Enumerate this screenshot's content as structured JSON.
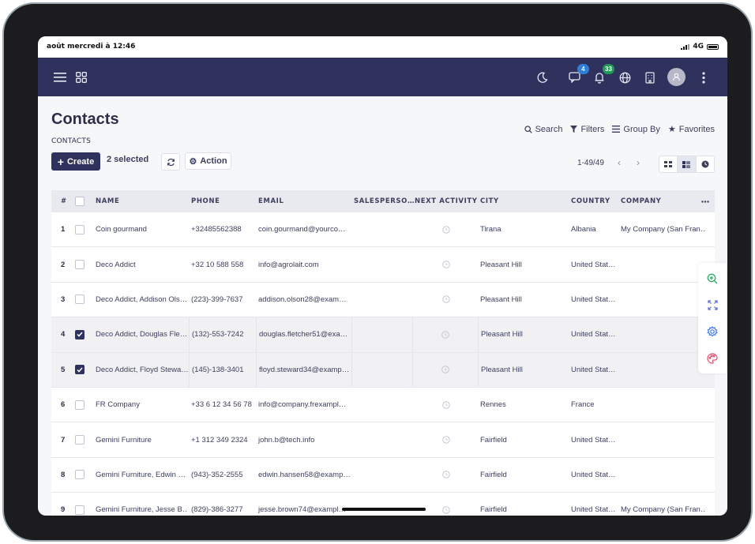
{
  "status_bar": {
    "datetime": "août mercredi à 12:46",
    "network": "4G"
  },
  "topnav": {
    "menu_icon": "hamburger-icon",
    "apps_icon": "grid-icon",
    "theme_icon": "moon-icon",
    "messages_badge": "4",
    "notifications_badge": "33",
    "language_icon": "globe-icon",
    "company_icon": "building-icon",
    "more_icon": "kebab-icon",
    "colors": {
      "bar": "#30325e",
      "messages_badge": "#2f7fd8",
      "notifications_badge": "#1f9a57"
    }
  },
  "page": {
    "title": "Contacts",
    "breadcrumb": "CONTACTS"
  },
  "search": {
    "search_label": "Search",
    "filters_label": "Filters",
    "group_by_label": "Group By",
    "favorites_label": "Favorites"
  },
  "toolbar": {
    "create_label": "Create",
    "selected_text": "2 selected",
    "action_label": "Action"
  },
  "pager": {
    "range": "1-49/49"
  },
  "table": {
    "columns": {
      "num": "#",
      "name": "NAME",
      "phone": "PHONE",
      "email": "EMAIL",
      "salesperson": "SALESPERSO…",
      "next_activity": "NEXT ACTIVITY",
      "city": "CITY",
      "country": "COUNTRY",
      "company": "COMPANY"
    },
    "rows": [
      {
        "num": "1",
        "checked": false,
        "name": "Coin gourmand",
        "phone": "+32485562388",
        "email": "coin.gourmand@yourco…",
        "city": "Tirana",
        "country": "Albania",
        "company": "My Company (San Fran…"
      },
      {
        "num": "2",
        "checked": false,
        "name": "Deco Addict",
        "phone": "+32 10 588 558",
        "email": "info@agrolait.com",
        "city": "Pleasant Hill",
        "country": "United Stat…",
        "company": ""
      },
      {
        "num": "3",
        "checked": false,
        "name": "Deco Addict, Addison Ols…",
        "phone": "(223)-399-7637",
        "email": "addison.olson28@exam…",
        "city": "Pleasant Hill",
        "country": "United Stat…",
        "company": ""
      },
      {
        "num": "4",
        "checked": true,
        "name": "Deco Addict, Douglas Fle…",
        "phone": "(132)-553-7242",
        "email": "douglas.fletcher51@exa…",
        "city": "Pleasant Hill",
        "country": "United Stat…",
        "company": ""
      },
      {
        "num": "5",
        "checked": true,
        "name": "Deco Addict, Floyd Stewa…",
        "phone": "(145)-138-3401",
        "email": "floyd.steward34@examp…",
        "city": "Pleasant Hill",
        "country": "United Stat…",
        "company": ""
      },
      {
        "num": "6",
        "checked": false,
        "name": "FR Company",
        "phone": "+33 6 12 34 56 78",
        "email": "info@company.frexampl…",
        "city": "Rennes",
        "country": "France",
        "company": ""
      },
      {
        "num": "7",
        "checked": false,
        "name": "Gemini Furniture",
        "phone": "+1 312 349 2324",
        "email": "john.b@tech.info",
        "city": "Fairfield",
        "country": "United Stat…",
        "company": ""
      },
      {
        "num": "8",
        "checked": false,
        "name": "Gemini Furniture, Edwin …",
        "phone": "(943)-352-2555",
        "email": "edwin.hansen58@examp…",
        "city": "Fairfield",
        "country": "United Stat…",
        "company": ""
      },
      {
        "num": "9",
        "checked": false,
        "name": "Gemini Furniture, Jesse B…",
        "phone": "(829)-386-3277",
        "email": "jesse.brown74@exampl…",
        "city": "Fairfield",
        "country": "United Stat…",
        "company": "My Company (San Fran…"
      }
    ]
  },
  "side_tools": [
    "zoom-in-icon",
    "expand-icon",
    "settings-icon",
    "palette-icon"
  ]
}
